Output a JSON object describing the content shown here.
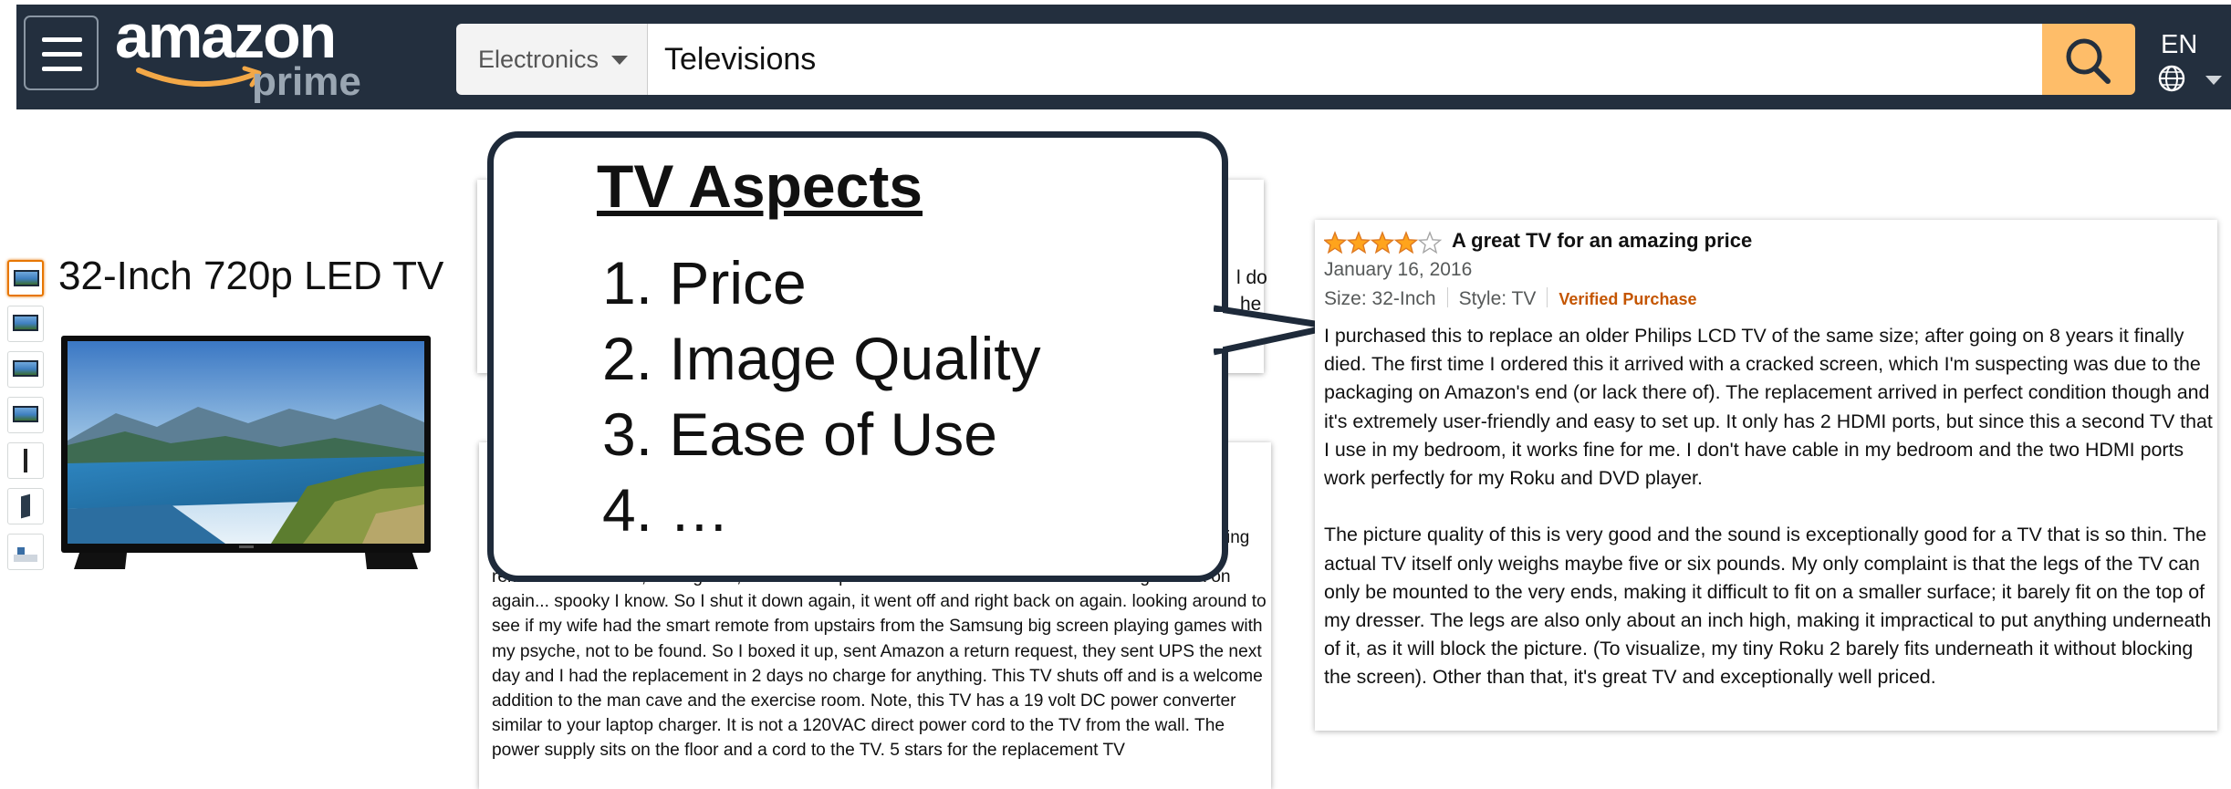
{
  "header": {
    "logo_main": "amazon",
    "logo_sub": "prime",
    "department": "Electronics",
    "search_value": "Televisions",
    "language": "EN"
  },
  "product": {
    "title": "32-Inch 720p LED TV",
    "thumbnail_count": 7,
    "selected_thumbnail": 0
  },
  "callout": {
    "heading": "TV Aspects",
    "items": [
      "1. Price",
      "2. Image Quality",
      "3. Ease of Use",
      "4. …"
    ]
  },
  "background_cards": {
    "top_fragment_1": "l do",
    "top_fragment_2": "he",
    "bottom_fragment_1": "ing",
    "bottom_body": [
      "remote to shut it off, it did go off, no audio or picture. Then 3 seconds later it came right back on",
      "again... spooky I know. So I shut it down again, it went off and right back on again. looking around to",
      "see if my wife had the smart remote from upstairs from the Samsung big screen playing games with",
      "my psyche, not to be found. So I boxed it up, sent Amazon a return request, they sent UPS the next",
      "day and I had the replacement in 2 days no charge for anything. This TV shuts off and is a welcome",
      "addition to the man cave and the exercise room. Note, this TV has a 19 volt DC power converter",
      "similar to your laptop charger. It is not a 120VAC direct power cord to the TV from the wall. The",
      "power supply sits on the floor and a cord to the TV. 5 stars for the replacement TV"
    ]
  },
  "review": {
    "rating": 4,
    "rating_max": 5,
    "title": "A great TV for an amazing price",
    "date": "January 16, 2016",
    "size": "Size: 32-Inch",
    "style": "Style: TV",
    "verified": "Verified Purchase",
    "paragraph_1": "I purchased this to replace an older Philips LCD TV of the same size; after going on 8 years it finally died. The first time I ordered this it arrived with a cracked screen, which I'm suspecting was due to the packaging on Amazon's end (or lack there of). The replacement arrived in perfect condition though and it's extremely user-friendly and easy to set up. It only has 2 HDMI ports, but since this a second TV that I use in my bedroom, it works fine for me. I don't have cable in my bedroom and the two HDMI ports work perfectly for my Roku and DVD player.",
    "paragraph_2": "The picture quality of this is very good and the sound is exceptionally good for a TV that is so thin. The actual TV itself only weighs maybe five or six pounds. My only complaint is that the legs of the TV can only be mounted to the very ends, making it difficult to fit on a smaller surface; it barely fit on the top of my dresser. The legs are also only about an inch high, making it impractical to put anything underneath of it, as it will block the picture. (To visualize, my tiny Roku 2 barely fits underneath it without blocking the screen). Other than that, it's great TV and exceptionally well priced."
  },
  "colors": {
    "header_bg": "#232f3e",
    "search_button": "#febd69",
    "star": "#ffa41c",
    "verified": "#c45500",
    "callout_border": "#1e2a3a"
  },
  "icons": [
    "menu-icon",
    "search-icon",
    "globe-icon",
    "chevron-down-icon",
    "star-icon"
  ]
}
